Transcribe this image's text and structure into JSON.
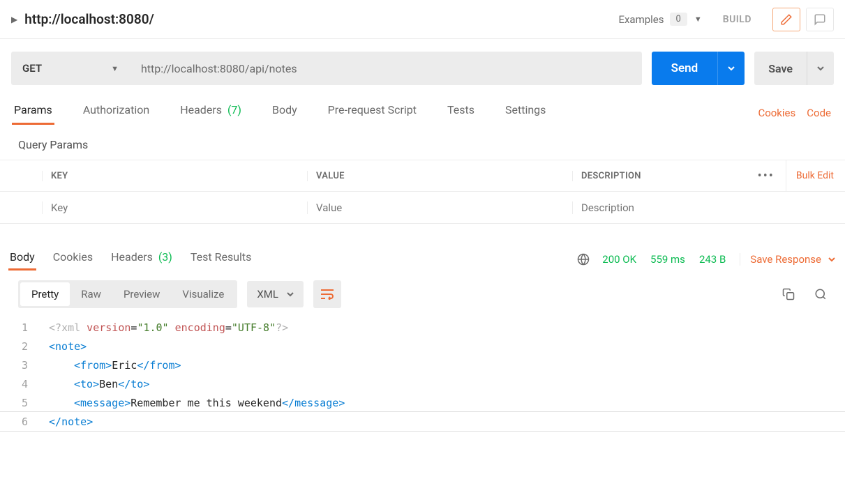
{
  "titlebar": {
    "title": "http://localhost:8080/",
    "examples_label": "Examples",
    "examples_count": "0",
    "build_label": "BUILD"
  },
  "request": {
    "method": "GET",
    "url": "http://localhost:8080/api/notes",
    "send_label": "Send",
    "save_label": "Save"
  },
  "req_tabs": {
    "params": "Params",
    "authorization": "Authorization",
    "headers": "Headers",
    "headers_count": "(7)",
    "body": "Body",
    "prerequest": "Pre-request Script",
    "tests": "Tests",
    "settings": "Settings",
    "cookies": "Cookies",
    "code": "Code"
  },
  "query_params": {
    "section": "Query Params",
    "key_header": "KEY",
    "value_header": "VALUE",
    "desc_header": "DESCRIPTION",
    "bulk_edit": "Bulk Edit",
    "key_placeholder": "Key",
    "value_placeholder": "Value",
    "desc_placeholder": "Description"
  },
  "resp_tabs": {
    "body": "Body",
    "cookies": "Cookies",
    "headers": "Headers",
    "headers_count": "(3)",
    "test_results": "Test Results",
    "status": "200 OK",
    "time": "559 ms",
    "size": "243 B",
    "save_response": "Save Response"
  },
  "viewbar": {
    "pretty": "Pretty",
    "raw": "Raw",
    "preview": "Preview",
    "visualize": "Visualize",
    "format": "XML"
  },
  "xml": {
    "l1_a": "<?",
    "l1_b": "xml",
    "l1_c": " version",
    "l1_d": "=",
    "l1_e": "\"1.0\"",
    "l1_f": " encoding",
    "l1_g": "=",
    "l1_h": "\"UTF-8\"",
    "l1_i": "?>",
    "l2_a": "<",
    "l2_b": "note",
    "l2_c": ">",
    "l3_a": "<",
    "l3_b": "from",
    "l3_c": ">",
    "l3_d": "Eric",
    "l3_e": "</",
    "l3_f": "from",
    "l3_g": ">",
    "l4_a": "<",
    "l4_b": "to",
    "l4_c": ">",
    "l4_d": "Ben",
    "l4_e": "</",
    "l4_f": "to",
    "l4_g": ">",
    "l5_a": "<",
    "l5_b": "message",
    "l5_c": ">",
    "l5_d": "Remember me this weekend",
    "l5_e": "</",
    "l5_f": "message",
    "l5_g": ">",
    "l6_a": "</",
    "l6_b": "note",
    "l6_c": ">",
    "n1": "1",
    "n2": "2",
    "n3": "3",
    "n4": "4",
    "n5": "5",
    "n6": "6"
  }
}
